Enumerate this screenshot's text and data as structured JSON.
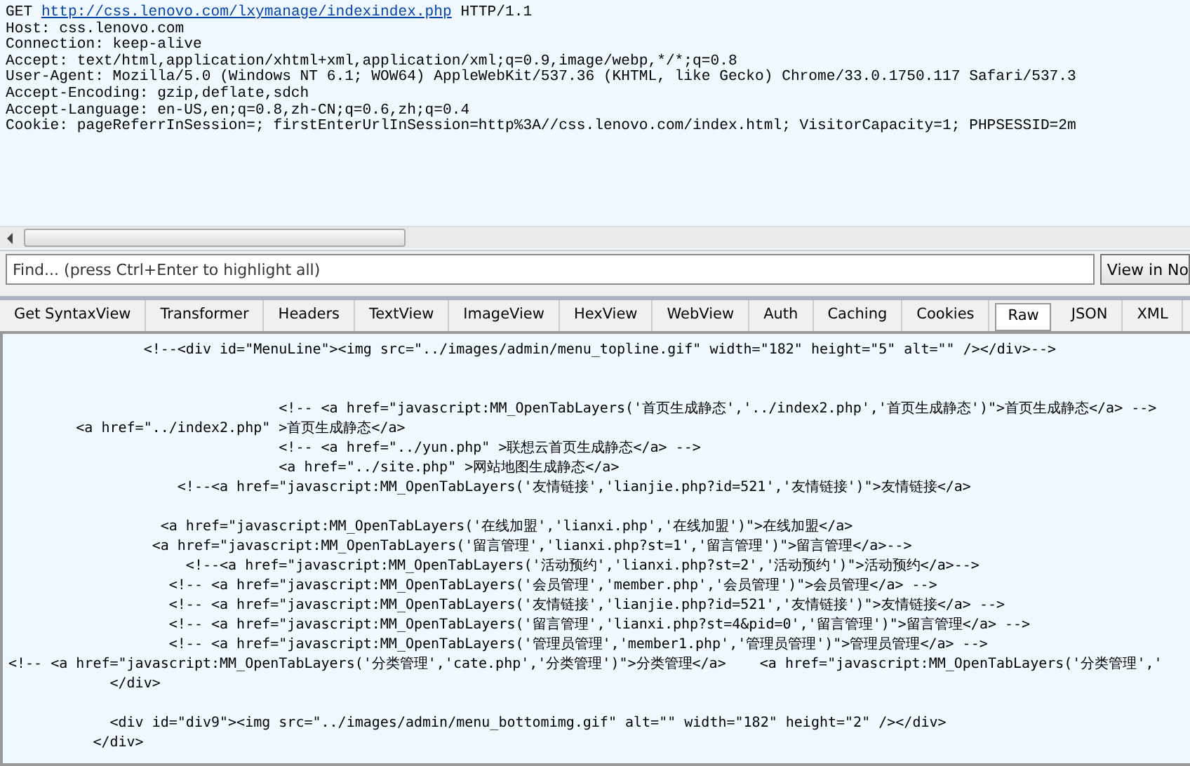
{
  "request": {
    "method": "GET",
    "url": "http://css.lenovo.com/lxymanage/indexindex.php",
    "version": "HTTP/1.1",
    "headers": [
      "Host: css.lenovo.com",
      "Connection: keep-alive",
      "Accept: text/html,application/xhtml+xml,application/xml;q=0.9,image/webp,*/*;q=0.8",
      "User-Agent: Mozilla/5.0 (Windows NT 6.1; WOW64) AppleWebKit/537.36 (KHTML, like Gecko) Chrome/33.0.1750.117 Safari/537.3",
      "Accept-Encoding: gzip,deflate,sdch",
      "Accept-Language: en-US,en;q=0.8,zh-CN;q=0.6,zh;q=0.4",
      "Cookie: pageReferrInSession=; firstEnterUrlInSession=http%3A//css.lenovo.com/index.html; VisitorCapacity=1; PHPSESSID=2m"
    ]
  },
  "find": {
    "placeholder": "Find... (press Ctrl+Enter to highlight all)",
    "button": "View in No"
  },
  "tabs": [
    {
      "label": "Get SyntaxView",
      "selected": false
    },
    {
      "label": "Transformer",
      "selected": false
    },
    {
      "label": "Headers",
      "selected": false
    },
    {
      "label": "TextView",
      "selected": false
    },
    {
      "label": "ImageView",
      "selected": false
    },
    {
      "label": "HexView",
      "selected": false
    },
    {
      "label": "WebView",
      "selected": false
    },
    {
      "label": "Auth",
      "selected": false
    },
    {
      "label": "Caching",
      "selected": false
    },
    {
      "label": "Cookies",
      "selected": false
    },
    {
      "label": "Raw",
      "selected": true
    },
    {
      "label": "JSON",
      "selected": false
    },
    {
      "label": "XML",
      "selected": false
    }
  ],
  "response_blocks": [
    [
      "                <!--<div id=\"MenuLine\"><img src=\"../images/admin/menu_topline.gif\" width=\"182\" height=\"5\" alt=\"\" /></div>-->"
    ],
    [
      "                                <!-- <a href=\"javascript:MM_OpenTabLayers('首页生成静态','../index2.php','首页生成静态')\">首页生成静态</a> -->",
      "        <a href=\"../index2.php\" >首页生成静态</a>",
      "                                <!-- <a href=\"../yun.php\" >联想云首页生成静态</a> -->",
      "                                <a href=\"../site.php\" >网站地图生成静态</a>",
      "                    <!--<a href=\"javascript:MM_OpenTabLayers('友情链接','lianjie.php?id=521','友情链接')\">友情链接</a>"
    ],
    [
      "                  <a href=\"javascript:MM_OpenTabLayers('在线加盟','lianxi.php','在线加盟')\">在线加盟</a>",
      "                 <a href=\"javascript:MM_OpenTabLayers('留言管理','lianxi.php?st=1','留言管理')\">留言管理</a>-->",
      "                     <!--<a href=\"javascript:MM_OpenTabLayers('活动预约','lianxi.php?st=2','活动预约')\">活动预约</a>-->",
      "                   <!-- <a href=\"javascript:MM_OpenTabLayers('会员管理','member.php','会员管理')\">会员管理</a> -->",
      "                   <!-- <a href=\"javascript:MM_OpenTabLayers('友情链接','lianjie.php?id=521','友情链接')\">友情链接</a> -->",
      "                   <!-- <a href=\"javascript:MM_OpenTabLayers('留言管理','lianxi.php?st=4&pid=0','留言管理')\">留言管理</a> -->",
      "                   <!-- <a href=\"javascript:MM_OpenTabLayers('管理员管理','member1.php','管理员管理')\">管理员管理</a> -->",
      "<!-- <a href=\"javascript:MM_OpenTabLayers('分类管理','cate.php','分类管理')\">分类管理</a>    <a href=\"javascript:MM_OpenTabLayers('分类管理','",
      "            </div>"
    ],
    [
      "            <div id=\"div9\"><img src=\"../images/admin/menu_bottomimg.gif\" alt=\"\" width=\"182\" height=\"2\" /></div>",
      "          </div>"
    ]
  ]
}
